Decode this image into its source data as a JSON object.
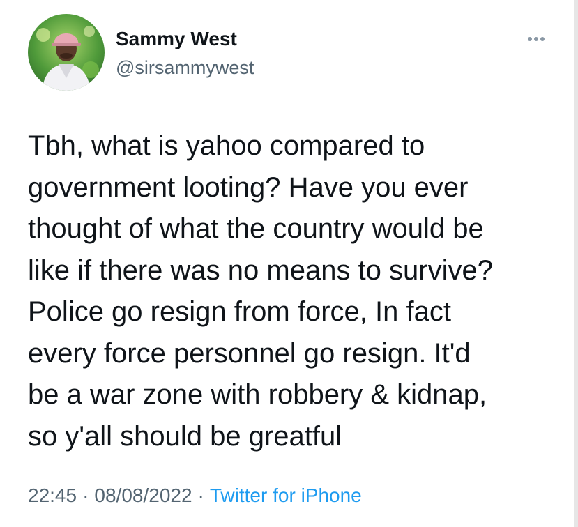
{
  "author": {
    "display_name": "Sammy West",
    "handle": "@sirsammywest",
    "avatar_icon": "profile-photo"
  },
  "more_icon": "more-dots-icon",
  "tweet": {
    "lines": [
      "Tbh, what is yahoo compared to",
      "government looting? Have you ever",
      "thought of what the country would be",
      "like if there was no means to survive?",
      "Police go resign from force, In fact",
      "every force personnel go resign. It'd",
      "be a war zone with robbery & kidnap,",
      "so y'all should be greatful"
    ]
  },
  "meta": {
    "time": "22:45",
    "date": "08/08/2022",
    "separator": "·",
    "source": "Twitter for iPhone"
  },
  "colors": {
    "text": "#0f1419",
    "secondary": "#536471",
    "link": "#1d9bf0"
  }
}
